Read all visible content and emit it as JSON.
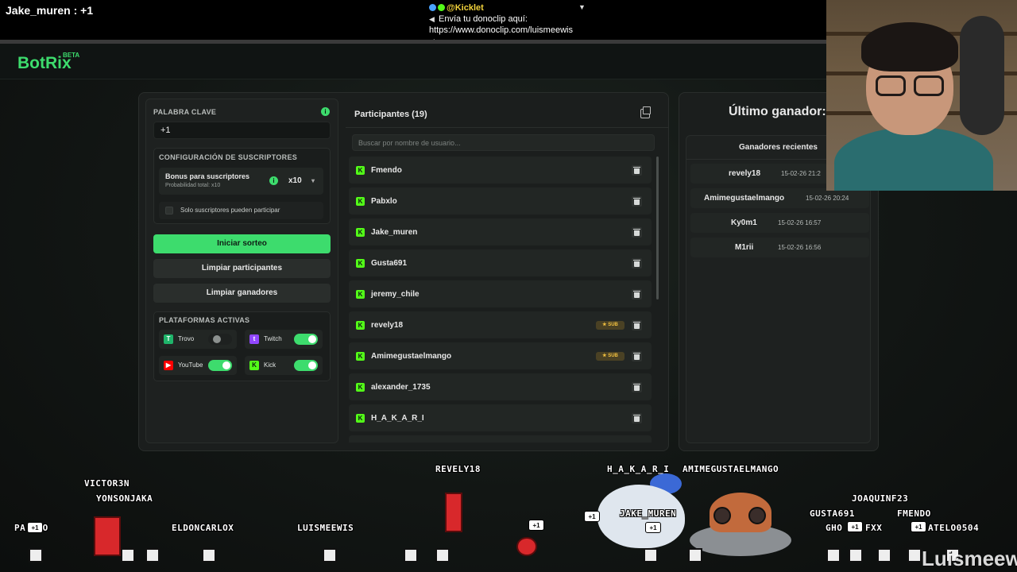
{
  "stream": {
    "chat_latest": "Jake_muren : +1",
    "notification_user": "@Kicklet",
    "notification_line1": "Envía tu donoclip aquí:",
    "notification_line2": "https://www.donoclip.com/luismeewis"
  },
  "brand": {
    "name": "BotRix",
    "beta": "BETA"
  },
  "left": {
    "keyword_label": "PALABRA CLAVE",
    "keyword_value": "+1",
    "subs_config_label": "CONFIGURACIÓN DE SUSCRIPTORES",
    "bonus_title": "Bonus para suscriptores",
    "bonus_sub": "Probabilidad total: x10",
    "multiplier": "x10",
    "only_subs_label": "Solo suscriptores pueden participar",
    "start_button": "Iniciar sorteo",
    "clear_participants_button": "Limpiar participantes",
    "clear_winners_button": "Limpiar ganadores",
    "platforms_label": "PLATAFORMAS ACTIVAS",
    "platforms": [
      {
        "name": "Trovo",
        "active": false,
        "color": "#1fb46a"
      },
      {
        "name": "Twitch",
        "active": true,
        "color": "#9146ff"
      },
      {
        "name": "YouTube",
        "active": true,
        "color": "#ff0000"
      },
      {
        "name": "Kick",
        "active": true,
        "color": "#53fc18"
      }
    ]
  },
  "participants": {
    "title": "Participantes (19)",
    "search_placeholder": "Buscar por nombre de usuario...",
    "sub_badge": "SUB",
    "items": [
      {
        "name": "Fmendo",
        "sub": false
      },
      {
        "name": "Pabxlo",
        "sub": false
      },
      {
        "name": "Jake_muren",
        "sub": false
      },
      {
        "name": "Gusta691",
        "sub": false
      },
      {
        "name": "jeremy_chile",
        "sub": false
      },
      {
        "name": "revely18",
        "sub": true
      },
      {
        "name": "Amimegustaelmango",
        "sub": true
      },
      {
        "name": "alexander_1735",
        "sub": false
      },
      {
        "name": "H_A_K_A_R_I",
        "sub": false
      }
    ]
  },
  "winners": {
    "last_winner_label": "Último ganador: -",
    "recent_title": "Ganadores recientes",
    "items": [
      {
        "name": "revely18",
        "date": "15-02-26 21:2"
      },
      {
        "name": "Amimegustaelmango",
        "date": "15-02-26 20:24"
      },
      {
        "name": "Ky0m1",
        "date": "15-02-26 16:57"
      },
      {
        "name": "M1rii",
        "date": "15-02-26 16:56"
      }
    ]
  },
  "game": {
    "plus_one": "+1",
    "names": [
      "VICTOR3N",
      "YONSONJAKA",
      "PA...O",
      "ELDONCARLOX",
      "LUISMEEWIS",
      "REVELY18",
      "H_A_K_A_R_I",
      "AMIMEGUSTAELMANGO",
      "JAKE_MUREN",
      "JOAQUINF23",
      "GUSTA691",
      "FMENDO",
      "GHO",
      "FXX",
      "ATELO0504"
    ],
    "watermark": "Luismeewis"
  },
  "colors": {
    "accent": "#3ddc6d",
    "kick": "#53fc18",
    "sub_gold": "#f0c040"
  }
}
